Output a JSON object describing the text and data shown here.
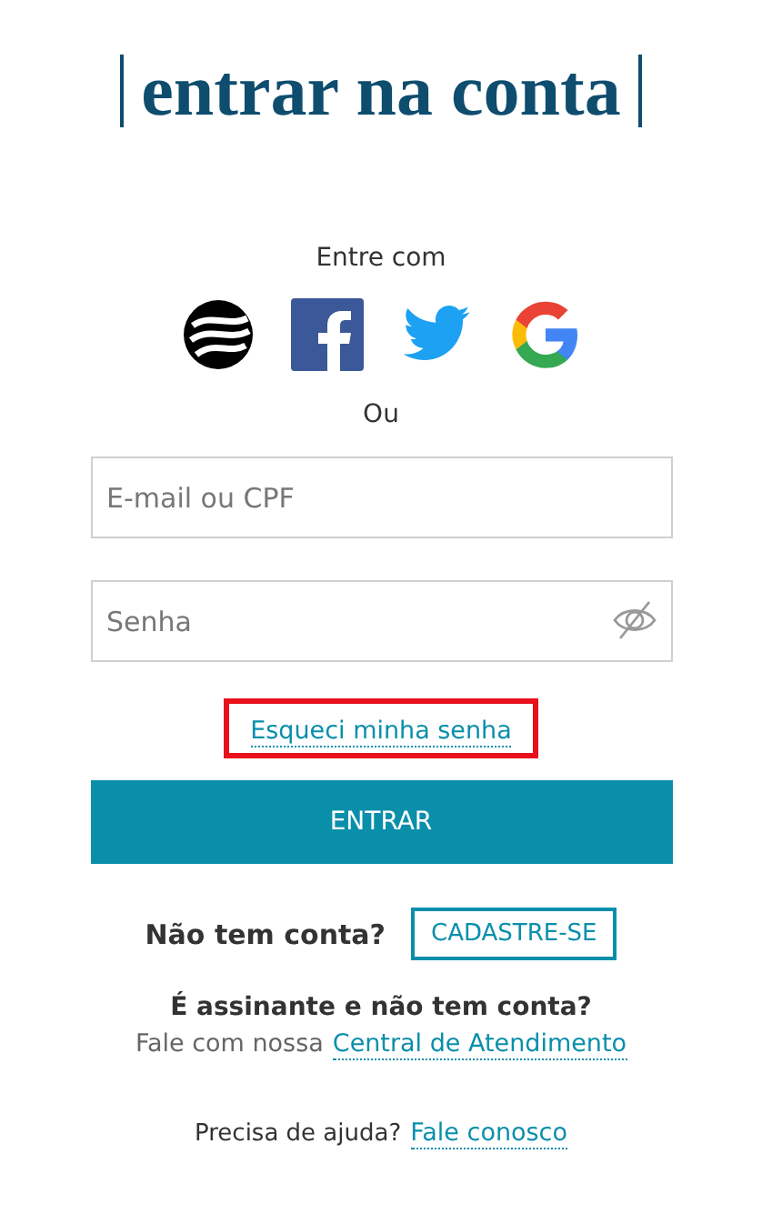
{
  "title": "entrar na conta",
  "social": {
    "label": "Entre com",
    "providers": [
      {
        "kind": "globo"
      },
      {
        "kind": "facebook"
      },
      {
        "kind": "twitter"
      },
      {
        "kind": "google"
      }
    ]
  },
  "separator": "Ou",
  "fields": [
    {
      "placeholder": "E-mail ou CPF",
      "kind": "text"
    },
    {
      "placeholder": "Senha",
      "kind": "password"
    }
  ],
  "forgot_link": {
    "label": "Esqueci minha senha",
    "highlighted": true
  },
  "submit": "ENTRAR",
  "signup": {
    "question": "Não tem conta?",
    "button": "CADASTRE-SE"
  },
  "subscriber": {
    "question": "É assinante e não tem conta?",
    "text": "Fale com nossa",
    "link": "Central de Atendimento"
  },
  "help": {
    "text": "Precisa de ajuda?",
    "link": "Fale conosco"
  }
}
